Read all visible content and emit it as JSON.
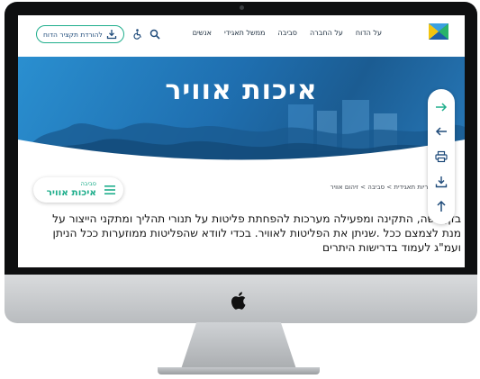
{
  "header": {
    "nav_items": [
      "על הדוח",
      "על החברה",
      "סביבה",
      "ממשל תאגידי",
      "אנשים"
    ],
    "download_label": "להורדת תקציר הדוח"
  },
  "hero": {
    "title": "איכות אוויר"
  },
  "topic_chip": {
    "category": "סביבה",
    "title": "איכות אוויר"
  },
  "breadcrumb": "א דוח אחריות תאגידית > סביבה > זיהום אוויר",
  "body_lines": [
    "בזן, כשה, התקינה ומפעילה מערכות להפחתת פליטות על תנורי תהליך ומתקני הייצור על",
    "מנת לצמצם ככל .שניתן את הפליטות לאוויר. בכדי לוודא שהפליטות ממוזערות ככל הניתן",
    "ועמ\"ג לעמוד בדרישות היתרים"
  ],
  "icons": {
    "logo": "company-logo",
    "search": "search-icon",
    "accessibility": "accessibility-icon",
    "download": "download-icon",
    "forward": "arrow-right-icon",
    "back": "arrow-left-icon",
    "print": "print-icon",
    "save": "download-icon",
    "top": "arrow-up-icon",
    "menu": "hamburger-icon",
    "apple": "apple-logo-icon"
  },
  "colors": {
    "accent_green": "#1fae8c",
    "hero_blue": "#1f6fb0",
    "text_dark": "#141414",
    "nav_text": "#1a2b3c"
  }
}
